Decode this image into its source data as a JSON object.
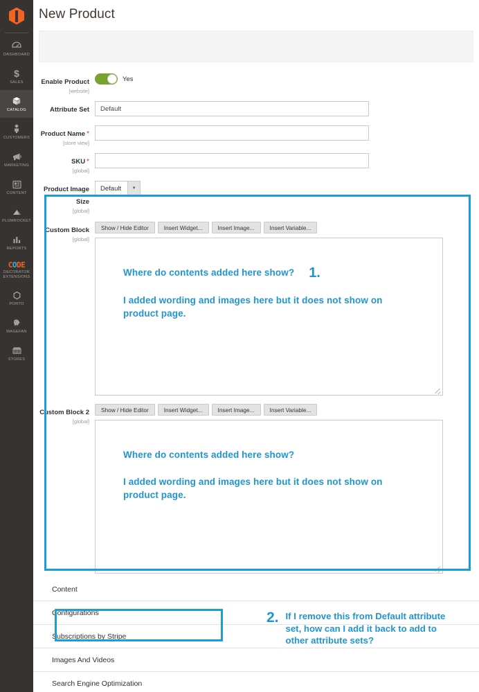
{
  "sidebar": {
    "logo_name": "magento-logo",
    "items": [
      {
        "label": "DASHBOARD",
        "icon": "dashboard-icon",
        "glyph": "◔",
        "active": false
      },
      {
        "label": "SALES",
        "icon": "sales-icon",
        "glyph": "$",
        "active": false
      },
      {
        "label": "CATALOG",
        "icon": "catalog-icon",
        "glyph": "◰",
        "active": true
      },
      {
        "label": "CUSTOMERS",
        "icon": "customers-icon",
        "glyph": "☖",
        "active": false
      },
      {
        "label": "MARKETING",
        "icon": "marketing-icon",
        "glyph": "📢",
        "active": false
      },
      {
        "label": "CONTENT",
        "icon": "content-icon",
        "glyph": "▤",
        "active": false
      },
      {
        "label": "PLUMROCKET",
        "icon": "plumrocket-icon",
        "glyph": "◣",
        "active": false
      },
      {
        "label": "REPORTS",
        "icon": "reports-icon",
        "glyph": "▥",
        "active": false
      },
      {
        "label": "DECORATOR\nEXTENSIONS",
        "icon": "code-decorator-extensions-icon",
        "glyph": "CODE",
        "active": false
      },
      {
        "label": "PORTO",
        "icon": "porto-icon",
        "glyph": "⬡",
        "active": false
      },
      {
        "label": "MAGEFAN",
        "icon": "magefan-icon",
        "glyph": "🐘",
        "active": false
      },
      {
        "label": "STORES",
        "icon": "stores-icon",
        "glyph": "🏪",
        "active": false
      }
    ]
  },
  "header": {
    "title": "New Product"
  },
  "form": {
    "enable_product": {
      "label": "Enable Product",
      "scope": "[website]",
      "toggle_value": "Yes",
      "toggle_on": true
    },
    "attribute_set": {
      "label": "Attribute Set",
      "value": "Default",
      "placeholder": ""
    },
    "product_name": {
      "label": "Product Name",
      "scope": "[store view]",
      "required": "*",
      "value": "",
      "placeholder": ""
    },
    "sku": {
      "label": "SKU",
      "scope": "[global]",
      "required": "*",
      "value": "",
      "placeholder": ""
    },
    "product_image_size": {
      "label": "Product Image Size",
      "scope": "[global]",
      "value": "Default",
      "arrow": "▼"
    }
  },
  "custom_block_1": {
    "label": "Custom Block",
    "scope": "[global]",
    "buttons": [
      "Show / Hide Editor",
      "Insert Widget...",
      "Insert Image...",
      "Insert Variable..."
    ]
  },
  "custom_block_2": {
    "label": "Custom Block 2",
    "scope": "[global]",
    "buttons": [
      "Show / Hide Editor",
      "Insert Widget...",
      "Insert Image...",
      "Insert Variable..."
    ]
  },
  "annotations": {
    "one": {
      "number": "1.",
      "line1": "Where do contents added here show?",
      "line2": "I added wording and images here but it does not show on product page."
    },
    "block2": {
      "line1": "Where do contents added here show?",
      "line2": "I added wording and images here but it does not show on product page."
    },
    "two": {
      "number": "2.",
      "text": "If I remove this from Default attribute set, how can I add it back to add to other attribute sets?"
    },
    "color": "#2196ce",
    "frame_color": "#1b9dd9"
  },
  "sections": [
    {
      "label": "Content",
      "highlighted": false
    },
    {
      "label": "Configurations",
      "highlighted": false
    },
    {
      "label": "Subscriptions by Stripe",
      "highlighted": true
    },
    {
      "label": "Images And Videos",
      "highlighted": false
    },
    {
      "label": "Search Engine Optimization",
      "highlighted": false
    }
  ]
}
